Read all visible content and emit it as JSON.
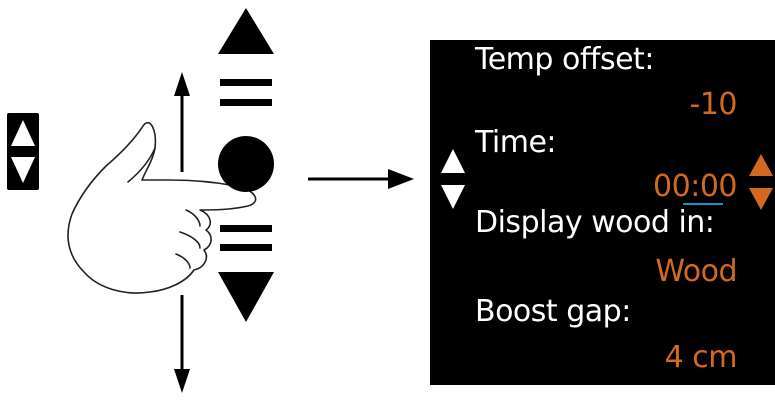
{
  "colors": {
    "background": "#ffffff",
    "screen_background": "#000000",
    "label_text": "#ffffff",
    "value_text": "#d2691e",
    "cursor": "#1e90c8",
    "ink": "#000000"
  },
  "icons": {
    "left_indicator": "up-down-arrows-icon",
    "hand": "pointing-hand-icon",
    "drag_up": "arrow-up-icon",
    "drag_down": "arrow-down-icon",
    "control_up": "triangle-up-icon",
    "control_middle": "circle-icon",
    "control_down": "triangle-down-icon",
    "transition": "arrow-right-icon",
    "screen_nav": "up-down-arrows-icon",
    "value_adjust": "up-down-arrows-icon"
  },
  "screen": {
    "settings": [
      {
        "label": "Temp offset:",
        "value": "-10"
      },
      {
        "label": "Time:",
        "value_prefix": "00:",
        "value_editing": "00"
      },
      {
        "label": "Display wood in:",
        "value": "Wood"
      },
      {
        "label": "Boost gap:",
        "value": "4 cm"
      }
    ]
  }
}
